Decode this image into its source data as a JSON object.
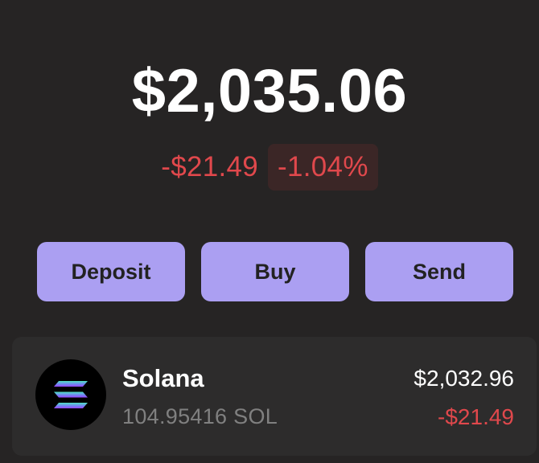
{
  "portfolio": {
    "total_balance": "$2,035.06",
    "change_amount": "-$21.49",
    "change_percent": "-1.04%"
  },
  "actions": {
    "deposit_label": "Deposit",
    "buy_label": "Buy",
    "send_label": "Send"
  },
  "tokens": [
    {
      "name": "Solana",
      "balance": "104.95416 SOL",
      "value": "$2,032.96",
      "change": "-$21.49",
      "icon": "solana-logo-icon"
    }
  ],
  "colors": {
    "background": "#262424",
    "card": "#2d2c2c",
    "accent": "#ab9ff2",
    "negative": "#e0484c",
    "negative_badge_bg": "#3b2626"
  }
}
